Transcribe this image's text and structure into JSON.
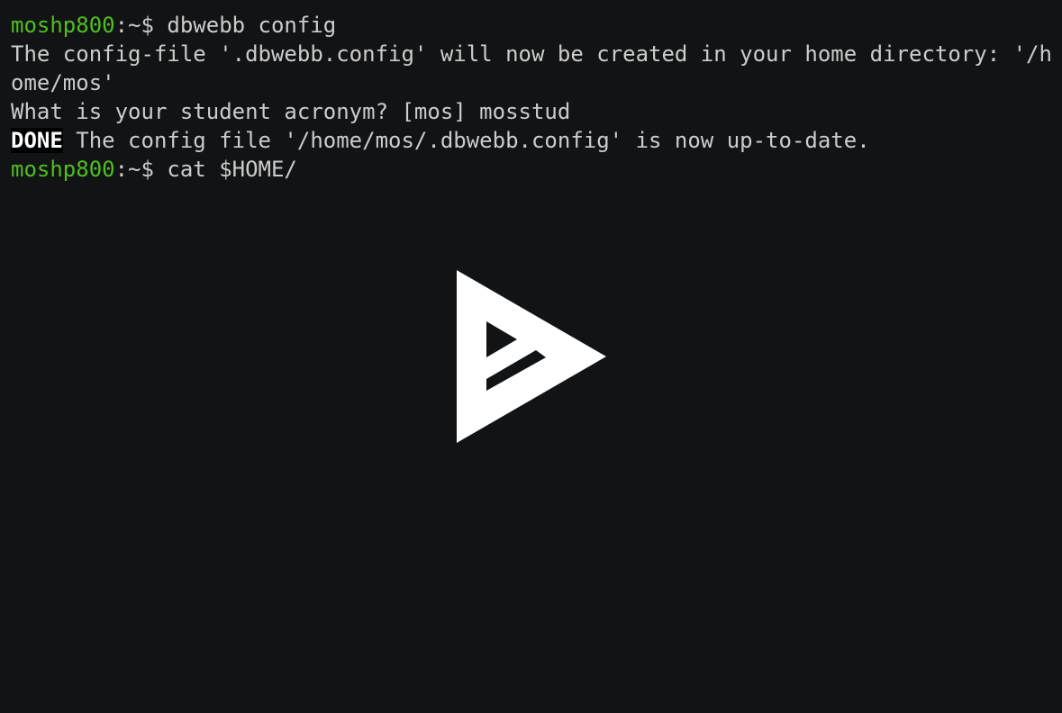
{
  "terminal": {
    "lines": [
      {
        "host": "moshp800",
        "prompt_suffix": ":~$ ",
        "command": "dbwebb config"
      },
      {
        "text": "The config-file '.dbwebb.config' will now be created in your home directory: '/h"
      },
      {
        "text": "ome/mos'"
      },
      {
        "text": "What is your student acronym? [mos] mosstud"
      },
      {
        "badge": "DONE",
        "text": " The config file '/home/mos/.dbwebb.config' is now up-to-date."
      },
      {
        "host": "moshp800",
        "prompt_suffix": ":~$ ",
        "command": "cat $HOME/"
      }
    ]
  },
  "overlay": {
    "icon": "asciinema-play-icon",
    "color": "#ffffff"
  },
  "colors": {
    "background": "#121314",
    "text": "#cccccc",
    "prompt_host": "#4ebf22"
  }
}
